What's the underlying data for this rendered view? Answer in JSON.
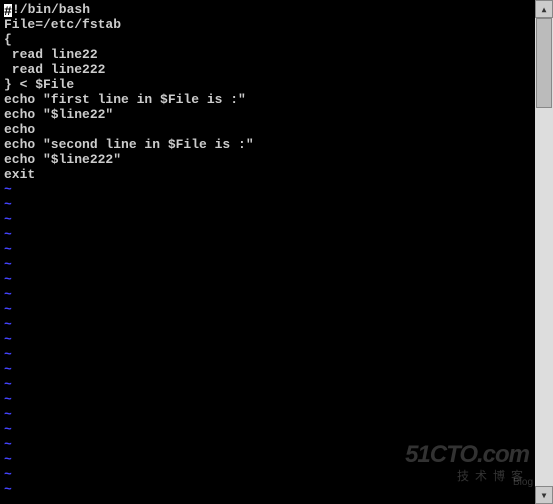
{
  "code": {
    "lines": [
      "#!/bin/bash",
      "File=/etc/fstab",
      "{",
      " read line22",
      " read line222",
      "} < $File",
      "echo \"first line in $File is :\"",
      "echo \"$line22\"",
      "echo",
      "echo \"second line in $File is :\"",
      "echo \"$line222\"",
      "exit"
    ],
    "cursor_line": 0,
    "cursor_col": 0,
    "tilde_count": 20,
    "tilde_char": "~"
  },
  "watermark": {
    "main": "51CTO.com",
    "sub": "技术博客",
    "blog": "Blog"
  }
}
